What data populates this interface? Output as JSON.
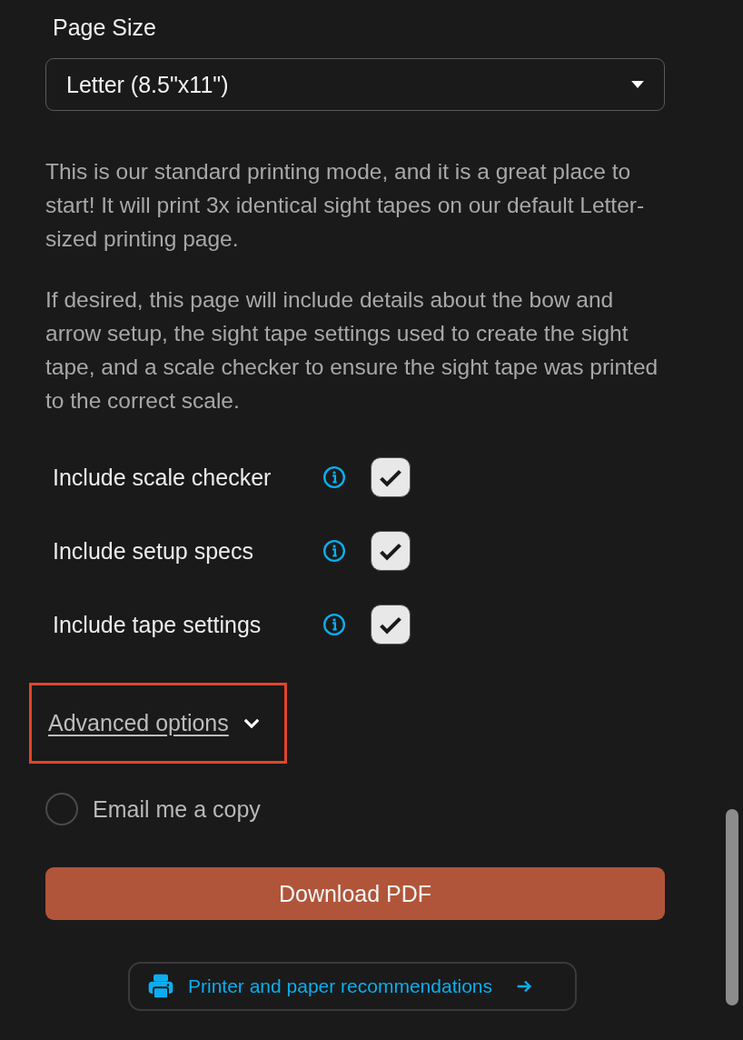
{
  "page_size": {
    "label": "Page Size",
    "value": "Letter (8.5\"x11\")"
  },
  "paragraphs": [
    "This is our standard printing mode, and it is a great place to start! It will print 3x identical sight tapes on our default Letter-sized printing page.",
    "If desired, this page will include details about the bow and arrow setup, the sight tape settings used to create the sight tape, and a scale checker to ensure the sight tape was printed to the correct scale."
  ],
  "options": [
    {
      "label": "Include scale checker",
      "checked": true
    },
    {
      "label": "Include setup specs",
      "checked": true
    },
    {
      "label": "Include tape settings",
      "checked": true
    }
  ],
  "advanced": {
    "label": "Advanced options",
    "expanded": false,
    "highlighted": true
  },
  "email_copy": {
    "label": "Email me a copy",
    "checked": false
  },
  "download_button": "Download PDF",
  "recommendations_link": "Printer and paper recommendations"
}
